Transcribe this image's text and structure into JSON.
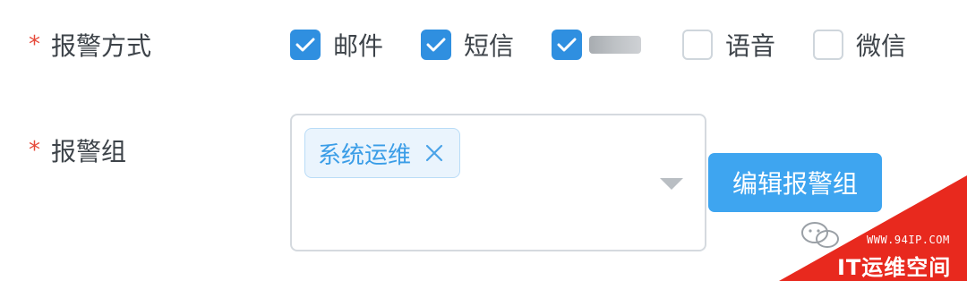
{
  "form": {
    "alert_method": {
      "required_mark": "*",
      "label": "报警方式",
      "options": [
        {
          "label": "邮件",
          "checked": true
        },
        {
          "label": "短信",
          "checked": true
        },
        {
          "label": "",
          "checked": true,
          "obscured": true
        },
        {
          "label": "语音",
          "checked": false
        },
        {
          "label": "微信",
          "checked": false
        }
      ]
    },
    "alert_group": {
      "required_mark": "*",
      "label": "报警组",
      "selected_tags": [
        "系统运维"
      ],
      "edit_button": "编辑报警组"
    }
  },
  "watermark": {
    "url": "WWW.94IP.COM",
    "title": "IT运维空间",
    "color": "#e8291e"
  },
  "colors": {
    "accent": "#2f8fe0",
    "button": "#3ea5f0",
    "required": "#e64a3b",
    "tag_text": "#3a9de7"
  }
}
